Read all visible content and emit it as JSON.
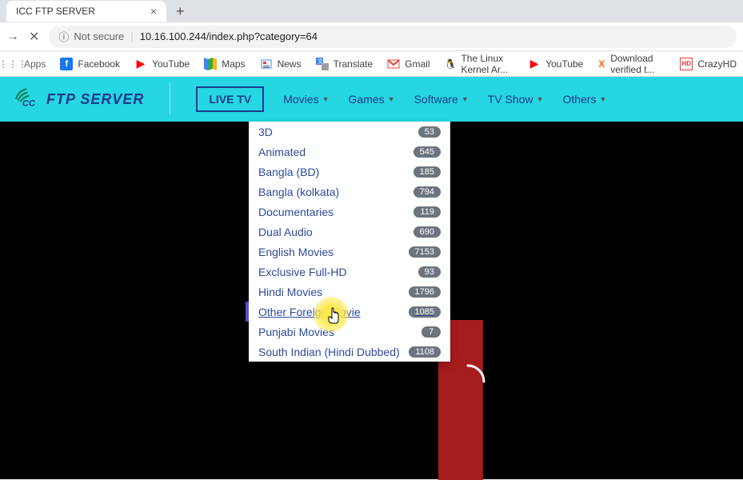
{
  "browser": {
    "tab_title": "ICC FTP SERVER",
    "not_secure_label": "Not secure",
    "url": "10.16.100.244/index.php?category=64"
  },
  "bookmarks": {
    "apps": "Apps",
    "items": [
      {
        "label": "Facebook",
        "icon": "facebook"
      },
      {
        "label": "YouTube",
        "icon": "youtube"
      },
      {
        "label": "Maps",
        "icon": "maps"
      },
      {
        "label": "News",
        "icon": "news"
      },
      {
        "label": "Translate",
        "icon": "translate"
      },
      {
        "label": "Gmail",
        "icon": "gmail"
      },
      {
        "label": "The Linux Kernel Ar...",
        "icon": "tux"
      },
      {
        "label": "YouTube",
        "icon": "youtube"
      },
      {
        "label": "Download verified t...",
        "icon": "x"
      },
      {
        "label": "CrazyHD",
        "icon": "hd"
      }
    ]
  },
  "site": {
    "brand": "FTP SERVER",
    "live_tv": "LIVE TV",
    "nav": [
      {
        "label": "Movies"
      },
      {
        "label": "Games"
      },
      {
        "label": "Software"
      },
      {
        "label": "TV Show"
      },
      {
        "label": "Others"
      }
    ]
  },
  "dropdown": [
    {
      "label": "3D",
      "count": "53"
    },
    {
      "label": "Animated",
      "count": "545"
    },
    {
      "label": "Bangla (BD)",
      "count": "185"
    },
    {
      "label": "Bangla (kolkata)",
      "count": "794"
    },
    {
      "label": "Documentaries",
      "count": "119"
    },
    {
      "label": "Dual Audio",
      "count": "690"
    },
    {
      "label": "English Movies",
      "count": "7153"
    },
    {
      "label": "Exclusive Full-HD",
      "count": "93"
    },
    {
      "label": "Hindi Movies",
      "count": "1796"
    },
    {
      "label": "Other Foreign Movie",
      "count": "1085",
      "hovered": true
    },
    {
      "label": "Punjabi Movies",
      "count": "7"
    },
    {
      "label": "South Indian (Hindi Dubbed)",
      "count": "1108"
    }
  ]
}
